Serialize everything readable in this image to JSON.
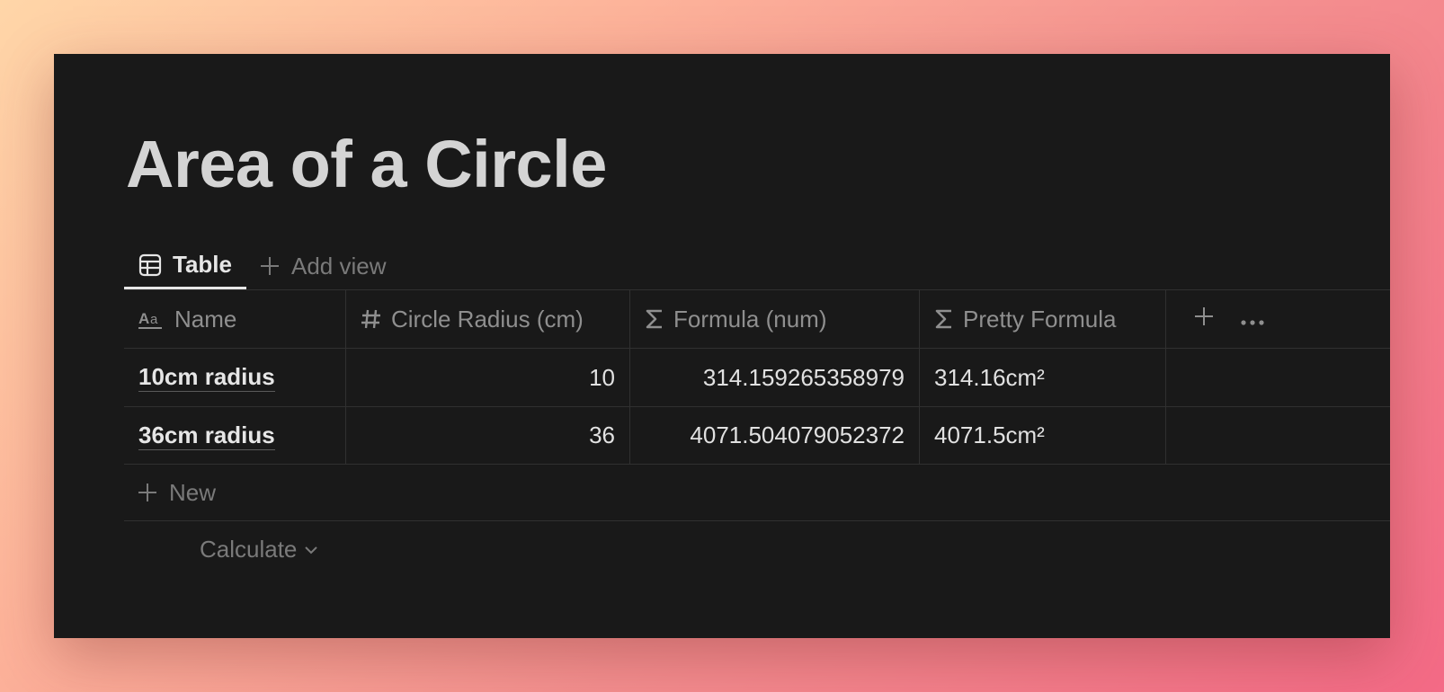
{
  "page": {
    "title": "Area of a Circle"
  },
  "views": {
    "tabs": [
      {
        "label": "Table",
        "icon": "table-icon"
      }
    ],
    "add_view_label": "Add view"
  },
  "table": {
    "columns": [
      {
        "label": "Name",
        "icon": "text-aa-icon"
      },
      {
        "label": "Circle Radius (cm)",
        "icon": "hash-icon"
      },
      {
        "label": "Formula (num)",
        "icon": "sigma-icon"
      },
      {
        "label": "Pretty Formula",
        "icon": "sigma-icon"
      }
    ],
    "rows": [
      {
        "name": "10cm radius",
        "radius": "10",
        "formula": "314.159265358979",
        "pretty": "314.16cm²"
      },
      {
        "name": "36cm radius",
        "radius": "36",
        "formula": "4071.504079052372",
        "pretty": "4071.5cm²"
      }
    ],
    "new_label": "New",
    "calculate_label": "Calculate"
  },
  "colors": {
    "window_bg": "#191919",
    "text_primary": "#e1e1e1",
    "text_muted": "#7a7a7a",
    "border": "#303030"
  }
}
